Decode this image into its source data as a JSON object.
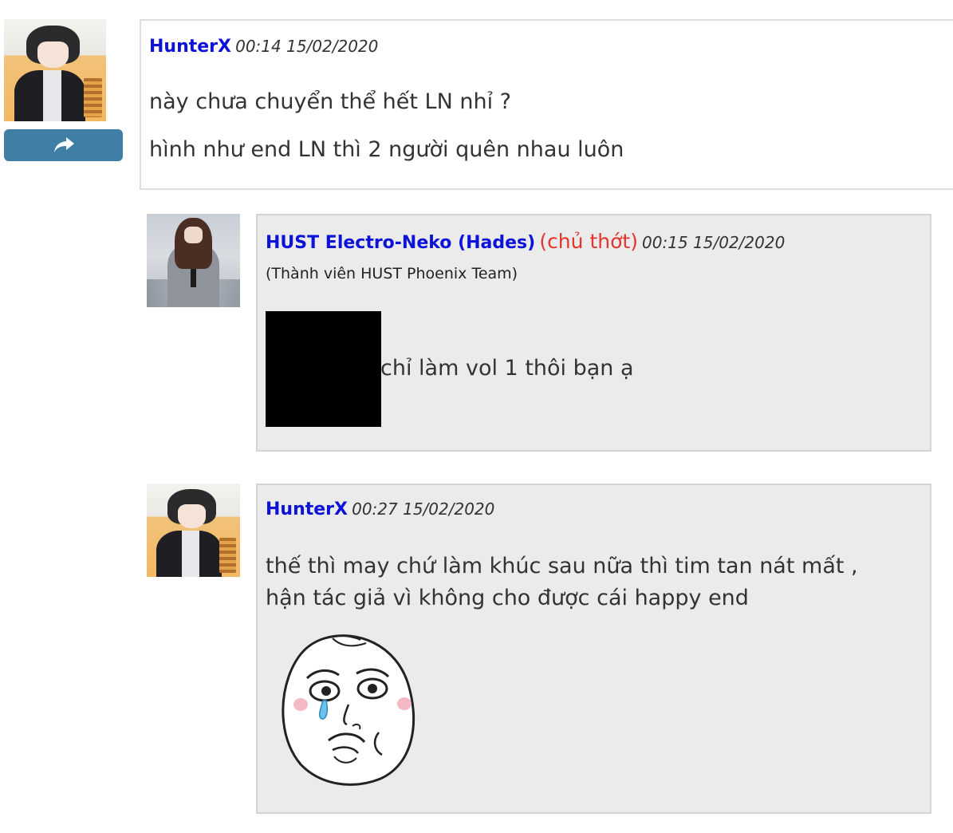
{
  "comments": [
    {
      "author": "HunterX",
      "time": "00:14 15/02/2020",
      "lines": [
        "này chưa chuyển thể hết LN nhỉ ?",
        "hình như end LN thì 2 người quên nhau luôn"
      ],
      "avatar": "anime-boy-avatar",
      "share_icon": "share-arrow-icon"
    }
  ],
  "replies": [
    {
      "author": "HUST Electro-Neko (Hades)",
      "op_tag": "(chủ thớt)",
      "time": "00:15 15/02/2020",
      "member": "(Thành viên HUST Phoenix Team)",
      "text": "chỉ làm vol 1 thôi bạn ạ",
      "avatar": "anime-girl-avatar"
    },
    {
      "author": "HunterX",
      "time": "00:27 15/02/2020",
      "lines": [
        "thế thì may chứ làm khúc sau nữa thì tim tan nát mất ,",
        "hận tác giả vì không cho được cái happy end"
      ],
      "sticker": "crying-meme-face-sticker",
      "avatar": "anime-boy-avatar"
    }
  ],
  "colors": {
    "author": "#0c12d8",
    "op_tag": "#e2352b",
    "share_button": "#3f7fa6",
    "reply_background": "#ebebeb"
  }
}
